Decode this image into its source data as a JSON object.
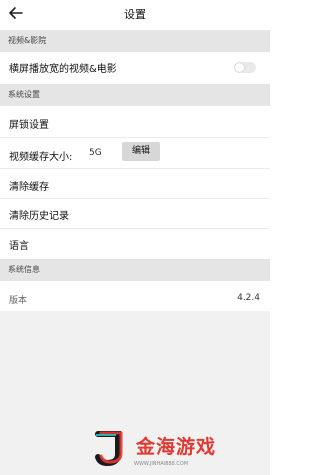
{
  "header": {
    "title": "设置"
  },
  "sections": {
    "video": "视频&影院",
    "system": "系统设置",
    "info": "系统信息"
  },
  "settings": {
    "landscape_label": "横屏播放宽的视频&电影",
    "landscape_enabled": false,
    "lock_screen": "屏锁设置",
    "cache_size_label": "视频缓存大小:",
    "cache_size_value": "5G",
    "edit_button": "编辑",
    "clear_cache": "清除缓存",
    "clear_history": "清除历史记录",
    "language": "语言"
  },
  "info": {
    "version_label": "版本",
    "version_value": "4.2.4"
  },
  "watermark": {
    "brand": "金海游戏",
    "site": "WWW.JINHAI888.COM"
  }
}
